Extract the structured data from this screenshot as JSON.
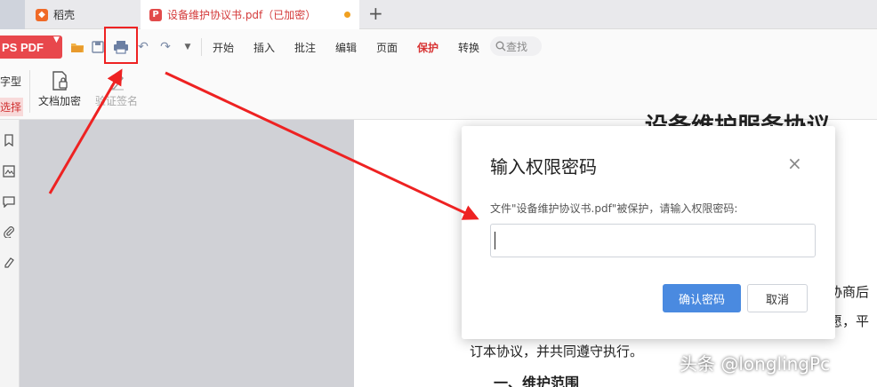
{
  "tabs": {
    "daoke_label": "稻壳",
    "doc_label": "设备维护协议书.pdf（已加密）",
    "new_tab_symbol": "+"
  },
  "toolbar": {
    "app_label": "PS PDF",
    "menus": [
      "开始",
      "插入",
      "批注",
      "编辑",
      "页面",
      "保护",
      "转换"
    ],
    "search_label": "查找",
    "active_menu_color": "#d83434",
    "icons": [
      "open-folder-icon",
      "save-icon",
      "print-icon",
      "undo-icon",
      "redo-icon",
      "dropdown-icon"
    ]
  },
  "ribbon": {
    "side_type": "字型",
    "side_select": "选择",
    "encrypt_label": "文档加密",
    "verify_label": "验证签名"
  },
  "left_panel": {
    "icons": [
      "bookmark-icon",
      "thumbnail-icon",
      "comment-icon",
      "attachment-icon",
      "signature-icon"
    ]
  },
  "document": {
    "title": "设备维护服务协议",
    "line1": "协商后",
    "line2": "愿，平",
    "line3": "订本协议，并共同遵守执行。",
    "heading": "一、维护范围"
  },
  "dialog": {
    "title": "输入权限密码",
    "close_symbol": "×",
    "prompt": "文件\"设备维护协议书.pdf\"被保护，请输入权限密码:",
    "password_value": "",
    "confirm_label": "确认密码",
    "cancel_label": "取消",
    "confirm_color": "#4a8ae0"
  },
  "annotation": {
    "highlight_color": "#ee2222",
    "watermark": "头条 @longlingPc"
  }
}
